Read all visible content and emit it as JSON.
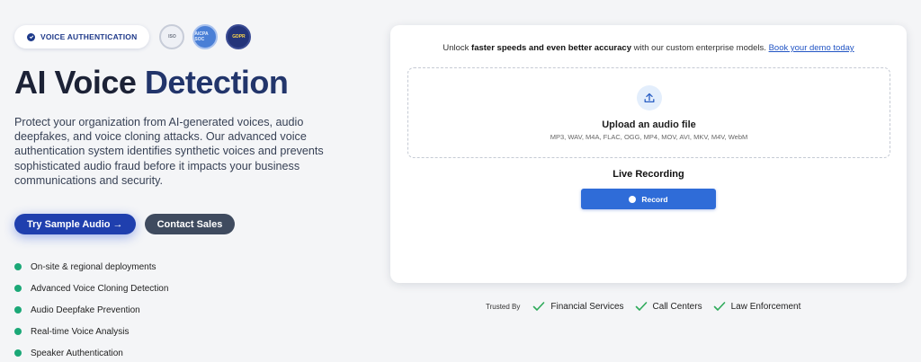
{
  "badge": {
    "label": "VOICE AUTHENTICATION"
  },
  "certs": [
    "ISO",
    "AICPA SOC",
    "GDPR"
  ],
  "hero": {
    "title_part1": "AI Voice ",
    "title_part2": "Detection",
    "description": "Protect your organization from AI-generated voices, audio deepfakes, and voice cloning attacks. Our advanced voice authentication system identifies synthetic voices and prevents sophisticated audio fraud before it impacts your business communications and security."
  },
  "buttons": {
    "sample": "Try Sample Audio →",
    "contact": "Contact Sales"
  },
  "features": [
    "On-site & regional deployments",
    "Advanced Voice Cloning Detection",
    "Audio Deepfake Prevention",
    "Real-time Voice Analysis",
    "Speaker Authentication"
  ],
  "card": {
    "promo_prefix": "Unlock ",
    "promo_bold": "faster speeds and even better accuracy",
    "promo_suffix": " with our custom enterprise models. ",
    "promo_link": "Book your demo today",
    "upload_title": "Upload an audio file",
    "upload_formats": "MP3, WAV, M4A, FLAC, OGG, MP4, MOV, AVI, MKV, M4V, WebM",
    "live_title": "Live Recording",
    "record_label": "Record"
  },
  "trusted": {
    "label": "Trusted By",
    "items": [
      "Financial Services",
      "Call Centers",
      "Law Enforcement"
    ]
  },
  "colors": {
    "primary": "#1f3fae",
    "record": "#2f6cd8",
    "feature_dot": "#1ba877",
    "check": "#2eaa5a"
  }
}
